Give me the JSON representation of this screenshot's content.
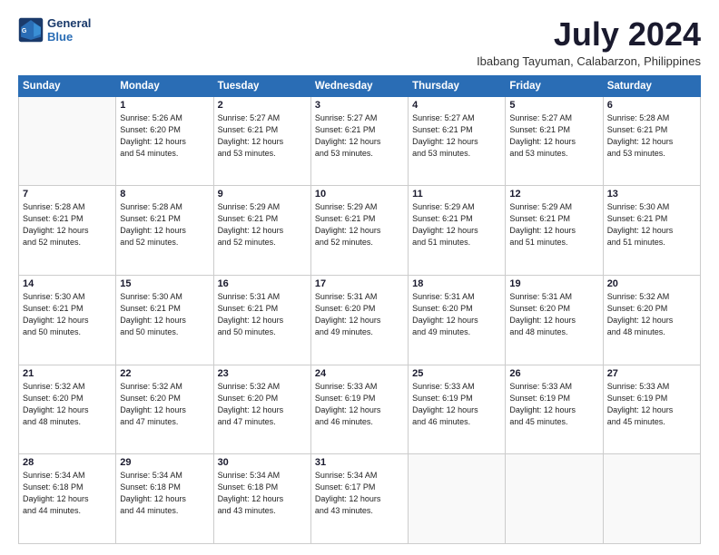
{
  "logo": {
    "line1": "General",
    "line2": "Blue"
  },
  "title": "July 2024",
  "subtitle": "Ibabang Tayuman, Calabarzon, Philippines",
  "days_header": [
    "Sunday",
    "Monday",
    "Tuesday",
    "Wednesday",
    "Thursday",
    "Friday",
    "Saturday"
  ],
  "weeks": [
    [
      {
        "day": "",
        "info": ""
      },
      {
        "day": "1",
        "info": "Sunrise: 5:26 AM\nSunset: 6:20 PM\nDaylight: 12 hours\nand 54 minutes."
      },
      {
        "day": "2",
        "info": "Sunrise: 5:27 AM\nSunset: 6:21 PM\nDaylight: 12 hours\nand 53 minutes."
      },
      {
        "day": "3",
        "info": "Sunrise: 5:27 AM\nSunset: 6:21 PM\nDaylight: 12 hours\nand 53 minutes."
      },
      {
        "day": "4",
        "info": "Sunrise: 5:27 AM\nSunset: 6:21 PM\nDaylight: 12 hours\nand 53 minutes."
      },
      {
        "day": "5",
        "info": "Sunrise: 5:27 AM\nSunset: 6:21 PM\nDaylight: 12 hours\nand 53 minutes."
      },
      {
        "day": "6",
        "info": "Sunrise: 5:28 AM\nSunset: 6:21 PM\nDaylight: 12 hours\nand 53 minutes."
      }
    ],
    [
      {
        "day": "7",
        "info": "Sunrise: 5:28 AM\nSunset: 6:21 PM\nDaylight: 12 hours\nand 52 minutes."
      },
      {
        "day": "8",
        "info": "Sunrise: 5:28 AM\nSunset: 6:21 PM\nDaylight: 12 hours\nand 52 minutes."
      },
      {
        "day": "9",
        "info": "Sunrise: 5:29 AM\nSunset: 6:21 PM\nDaylight: 12 hours\nand 52 minutes."
      },
      {
        "day": "10",
        "info": "Sunrise: 5:29 AM\nSunset: 6:21 PM\nDaylight: 12 hours\nand 52 minutes."
      },
      {
        "day": "11",
        "info": "Sunrise: 5:29 AM\nSunset: 6:21 PM\nDaylight: 12 hours\nand 51 minutes."
      },
      {
        "day": "12",
        "info": "Sunrise: 5:29 AM\nSunset: 6:21 PM\nDaylight: 12 hours\nand 51 minutes."
      },
      {
        "day": "13",
        "info": "Sunrise: 5:30 AM\nSunset: 6:21 PM\nDaylight: 12 hours\nand 51 minutes."
      }
    ],
    [
      {
        "day": "14",
        "info": "Sunrise: 5:30 AM\nSunset: 6:21 PM\nDaylight: 12 hours\nand 50 minutes."
      },
      {
        "day": "15",
        "info": "Sunrise: 5:30 AM\nSunset: 6:21 PM\nDaylight: 12 hours\nand 50 minutes."
      },
      {
        "day": "16",
        "info": "Sunrise: 5:31 AM\nSunset: 6:21 PM\nDaylight: 12 hours\nand 50 minutes."
      },
      {
        "day": "17",
        "info": "Sunrise: 5:31 AM\nSunset: 6:20 PM\nDaylight: 12 hours\nand 49 minutes."
      },
      {
        "day": "18",
        "info": "Sunrise: 5:31 AM\nSunset: 6:20 PM\nDaylight: 12 hours\nand 49 minutes."
      },
      {
        "day": "19",
        "info": "Sunrise: 5:31 AM\nSunset: 6:20 PM\nDaylight: 12 hours\nand 48 minutes."
      },
      {
        "day": "20",
        "info": "Sunrise: 5:32 AM\nSunset: 6:20 PM\nDaylight: 12 hours\nand 48 minutes."
      }
    ],
    [
      {
        "day": "21",
        "info": "Sunrise: 5:32 AM\nSunset: 6:20 PM\nDaylight: 12 hours\nand 48 minutes."
      },
      {
        "day": "22",
        "info": "Sunrise: 5:32 AM\nSunset: 6:20 PM\nDaylight: 12 hours\nand 47 minutes."
      },
      {
        "day": "23",
        "info": "Sunrise: 5:32 AM\nSunset: 6:20 PM\nDaylight: 12 hours\nand 47 minutes."
      },
      {
        "day": "24",
        "info": "Sunrise: 5:33 AM\nSunset: 6:19 PM\nDaylight: 12 hours\nand 46 minutes."
      },
      {
        "day": "25",
        "info": "Sunrise: 5:33 AM\nSunset: 6:19 PM\nDaylight: 12 hours\nand 46 minutes."
      },
      {
        "day": "26",
        "info": "Sunrise: 5:33 AM\nSunset: 6:19 PM\nDaylight: 12 hours\nand 45 minutes."
      },
      {
        "day": "27",
        "info": "Sunrise: 5:33 AM\nSunset: 6:19 PM\nDaylight: 12 hours\nand 45 minutes."
      }
    ],
    [
      {
        "day": "28",
        "info": "Sunrise: 5:34 AM\nSunset: 6:18 PM\nDaylight: 12 hours\nand 44 minutes."
      },
      {
        "day": "29",
        "info": "Sunrise: 5:34 AM\nSunset: 6:18 PM\nDaylight: 12 hours\nand 44 minutes."
      },
      {
        "day": "30",
        "info": "Sunrise: 5:34 AM\nSunset: 6:18 PM\nDaylight: 12 hours\nand 43 minutes."
      },
      {
        "day": "31",
        "info": "Sunrise: 5:34 AM\nSunset: 6:17 PM\nDaylight: 12 hours\nand 43 minutes."
      },
      {
        "day": "",
        "info": ""
      },
      {
        "day": "",
        "info": ""
      },
      {
        "day": "",
        "info": ""
      }
    ]
  ]
}
